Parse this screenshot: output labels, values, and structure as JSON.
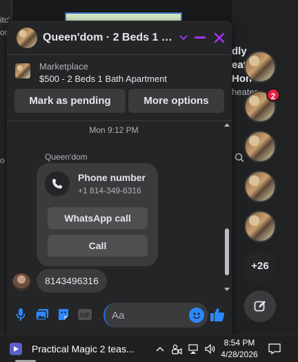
{
  "background": {
    "left_fragments": [
      "itc'",
      "or",
      "",
      "o"
    ],
    "right_fragments": [
      "dly",
      "eat",
      "Hon",
      "heater"
    ],
    "bubble_badge": "2",
    "more_count": "+26"
  },
  "chat": {
    "title": "Queen'dom · 2 Beds 1 Bath...",
    "marketplace": {
      "label": "Marketplace",
      "item": "$500 - 2 Beds 1 Bath Apartment",
      "mark_pending": "Mark as pending",
      "more_options": "More options"
    },
    "timestamp": "Mon 9:12 PM",
    "sender": "Queen'dom",
    "phone_card": {
      "title": "Phone number",
      "number": "+1 814-349-6316",
      "whatsapp_label": "WhatsApp call",
      "call_label": "Call"
    },
    "outgoing_message": "8143496316",
    "composer": {
      "placeholder": "Aa"
    }
  },
  "taskbar": {
    "app_label": "Practical Magic 2 teas...",
    "time": "8:54 PM",
    "date": "4/28/2026"
  },
  "colors": {
    "accent": "#2d88ff",
    "close_header": "#a933ff",
    "badge": "#e41e3f"
  }
}
